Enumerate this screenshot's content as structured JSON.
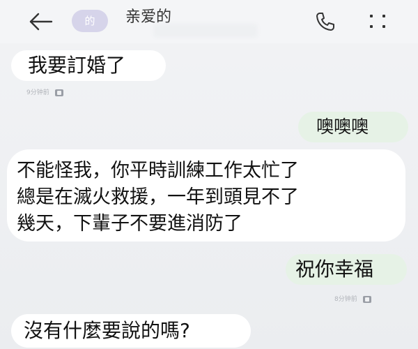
{
  "header": {
    "avatar_text": "的",
    "contact_name": "亲爱的",
    "icons": {
      "back": "arrow-left-icon",
      "call": "phone-icon",
      "more": "four-dots-icon"
    }
  },
  "messages": [
    {
      "direction": "incoming",
      "text": "我要訂婚了",
      "timestamp": "9分钟前"
    },
    {
      "direction": "outgoing",
      "text": "噢噢噢"
    },
    {
      "direction": "incoming",
      "lines": [
        "不能怪我，你平時訓練工作太忙了",
        "總是在滅火救援，一年到頭見不了",
        "幾天，下輩子不要進消防了"
      ]
    },
    {
      "direction": "outgoing",
      "text": "祝你幸福",
      "timestamp": "8分钟前"
    },
    {
      "direction": "incoming",
      "text": "沒有什麼要說的嗎?"
    }
  ],
  "colors": {
    "background": "#eceef1",
    "incoming_bubble": "#ffffff",
    "outgoing_bubble": "#e6f2e6",
    "avatar": "#d6d4ea",
    "timestamp": "#b1b4ba"
  }
}
